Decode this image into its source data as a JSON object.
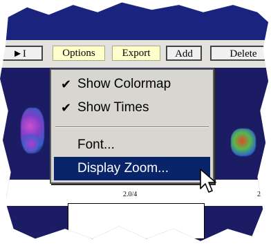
{
  "toolbar": {
    "buttons": [
      {
        "label": "►I"
      },
      {
        "label": "Options"
      },
      {
        "label": "Export"
      },
      {
        "label": "Add"
      },
      {
        "label": "Delete"
      }
    ]
  },
  "menu": {
    "items": [
      {
        "label": "Show Colormap",
        "checked": true
      },
      {
        "label": "Show Times",
        "checked": true
      },
      {
        "label": "Font..."
      },
      {
        "label": "Display Zoom...",
        "highlighted": true
      }
    ]
  },
  "scale": {
    "label_center": "2.0/4",
    "label_right": "2"
  },
  "colors": {
    "title_bar": "#1a237e",
    "canvas": "#1c1c64",
    "menu_bg": "#d8d6d0",
    "menu_highlight": "#0a246a",
    "button_yellow": "#ffffcc"
  },
  "icons": {
    "check": "check-icon",
    "cursor": "mouse-cursor-icon"
  }
}
